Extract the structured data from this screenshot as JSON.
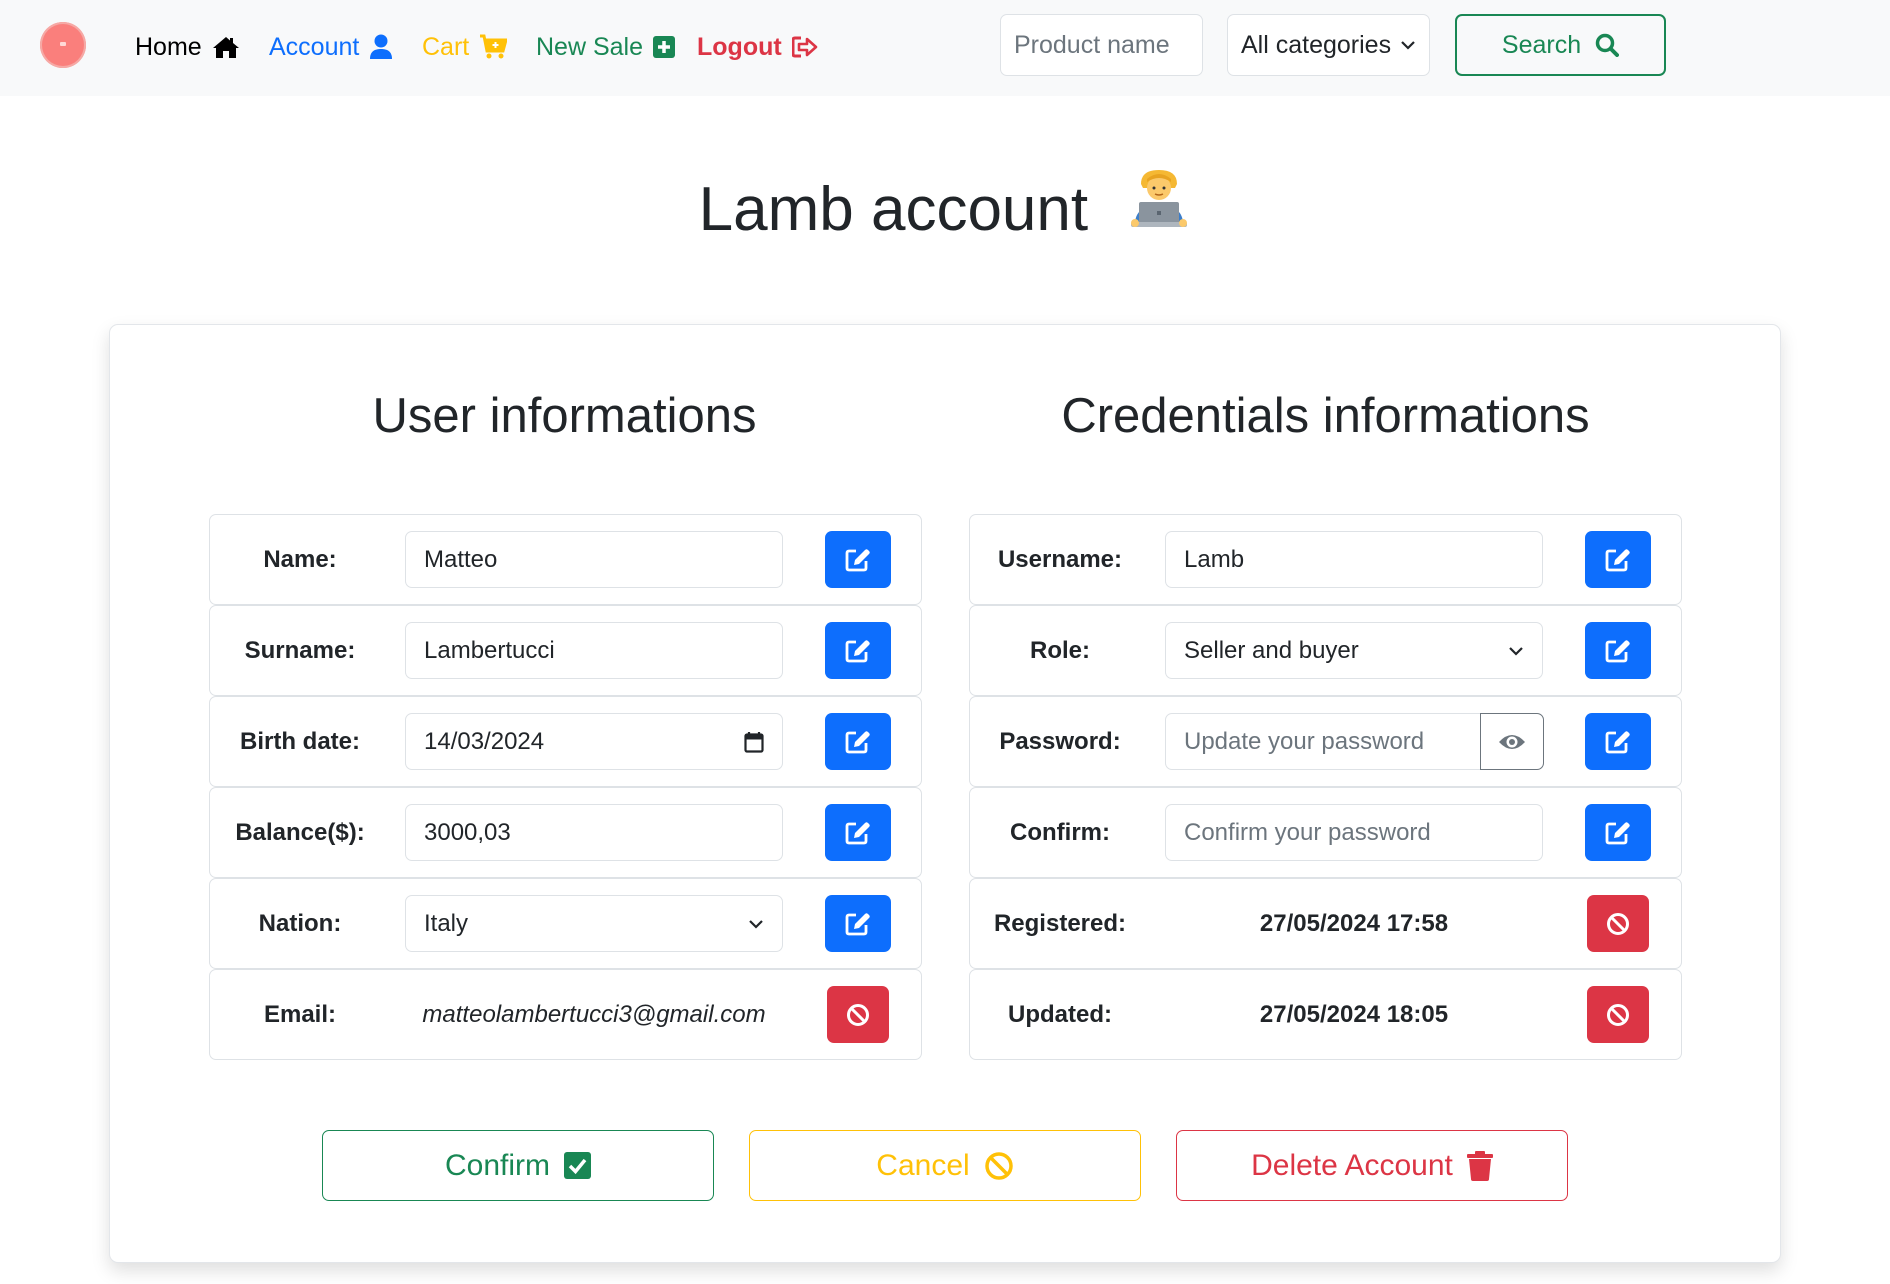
{
  "nav": {
    "home": "Home",
    "account": "Account",
    "cart": "Cart",
    "new_sale": "New Sale",
    "logout": "Logout",
    "search_placeholder": "Product name",
    "category": "All categories",
    "search": "Search"
  },
  "page_title": "Lamb account",
  "user_section": {
    "title": "User informations",
    "name_label": "Name:",
    "name_value": "Matteo",
    "surname_label": "Surname:",
    "surname_value": "Lambertucci",
    "birth_label": "Birth date:",
    "birth_value": "14/03/2024",
    "balance_label": "Balance($):",
    "balance_value": "3000,03",
    "nation_label": "Nation:",
    "nation_value": "Italy",
    "email_label": "Email:",
    "email_value": "matteolambertucci3@gmail.com"
  },
  "cred_section": {
    "title": "Credentials informations",
    "username_label": "Username:",
    "username_value": "Lamb",
    "role_label": "Role:",
    "role_value": "Seller and buyer",
    "password_label": "Password:",
    "password_placeholder": "Update your password",
    "confirm_label": "Confirm:",
    "confirm_placeholder": "Confirm your password",
    "registered_label": "Registered:",
    "registered_value": "27/05/2024 17:58",
    "updated_label": "Updated:",
    "updated_value": "27/05/2024 18:05"
  },
  "actions": {
    "confirm": "Confirm",
    "cancel": "Cancel",
    "delete": "Delete Account"
  },
  "colors": {
    "primary": "#0d6efd",
    "success": "#198754",
    "warning": "#ffc107",
    "danger": "#dc3545",
    "navbar_bg": "#f8f9fa"
  },
  "icons": {
    "home": "home-icon",
    "account": "user-icon",
    "cart": "cart-plus-icon",
    "new_sale": "plus-square-icon",
    "logout": "logout-icon",
    "search": "search-icon",
    "edit": "pen-to-square-icon",
    "locked": "ban-icon",
    "eye": "eye-icon",
    "confirm": "check-square-icon",
    "cancel": "ban-icon",
    "delete": "trash-icon",
    "title_emoji": "technologist-emoji"
  }
}
